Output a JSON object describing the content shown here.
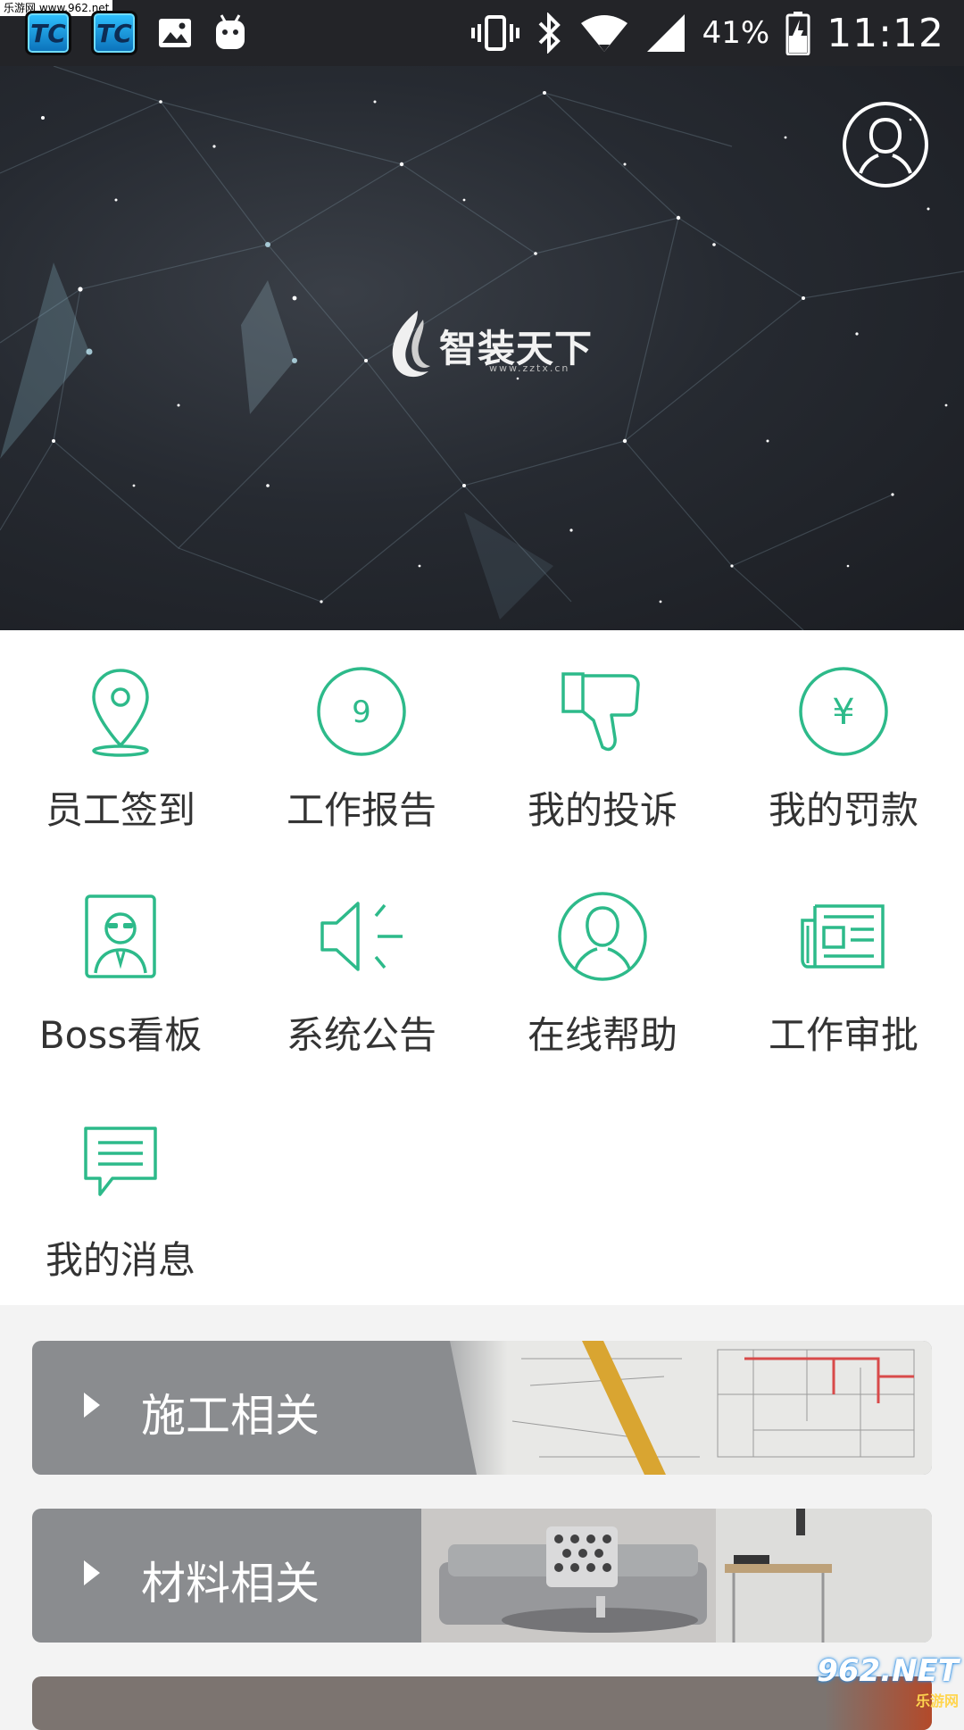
{
  "status_bar": {
    "watermark": "乐游网 www.962.net",
    "notif_app1": "TC",
    "notif_app2": "TC",
    "battery": "41%",
    "time": "11:12"
  },
  "banner": {
    "logo_text": "智装天下",
    "logo_url": "www.zztx.cn",
    "profile_icon": "user-circle-icon"
  },
  "accent_color": "#2dba8a",
  "grid": {
    "items": [
      {
        "label": "员工签到",
        "icon": "location-pin-icon"
      },
      {
        "label": "工作报告",
        "icon": "report-badge-icon",
        "badge": "9"
      },
      {
        "label": "我的投诉",
        "icon": "thumbs-down-icon"
      },
      {
        "label": "我的罚款",
        "icon": "yen-circle-icon",
        "glyph": "¥"
      },
      {
        "label": "Boss看板",
        "icon": "boss-portrait-icon"
      },
      {
        "label": "系统公告",
        "icon": "speaker-icon"
      },
      {
        "label": "在线帮助",
        "icon": "person-circle-icon"
      },
      {
        "label": "工作审批",
        "icon": "newspaper-icon"
      },
      {
        "label": "我的消息",
        "icon": "message-bubble-icon"
      }
    ]
  },
  "categories": [
    {
      "title": "施工相关"
    },
    {
      "title": "材料相关"
    }
  ],
  "footer_watermark": {
    "brand": "962.NET",
    "sub": "乐游网"
  }
}
